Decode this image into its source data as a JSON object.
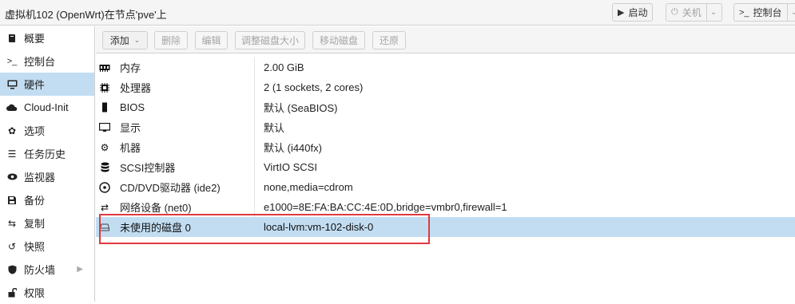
{
  "header": {
    "title": "虚拟机102 (OpenWrt)在节点'pve'上",
    "buttons": {
      "start": "启动",
      "shutdown": "关机",
      "console": "控制台"
    }
  },
  "sidebar": {
    "items": [
      {
        "label": "概要",
        "icon": "book-icon"
      },
      {
        "label": "控制台",
        "icon": "terminal-icon"
      },
      {
        "label": "硬件",
        "icon": "monitor-icon",
        "active": true
      },
      {
        "label": "Cloud-Init",
        "icon": "cloud-icon"
      },
      {
        "label": "选项",
        "icon": "gear-icon"
      },
      {
        "label": "任务历史",
        "icon": "list-icon"
      },
      {
        "label": "监视器",
        "icon": "eye-icon"
      },
      {
        "label": "备份",
        "icon": "floppy-icon"
      },
      {
        "label": "复制",
        "icon": "retweet-icon"
      },
      {
        "label": "快照",
        "icon": "history-icon"
      },
      {
        "label": "防火墙",
        "icon": "shield-icon"
      },
      {
        "label": "权限",
        "icon": "unlock-icon"
      }
    ]
  },
  "toolbar": {
    "add": "添加",
    "remove": "删除",
    "edit": "编辑",
    "resize": "调整磁盘大小",
    "move": "移动磁盘",
    "revert": "还原"
  },
  "hardware": [
    {
      "key": "内存",
      "value": "2.00 GiB",
      "icon": "memory-icon"
    },
    {
      "key": "处理器",
      "value": "2 (1 sockets, 2 cores)",
      "icon": "cpu-icon"
    },
    {
      "key": "BIOS",
      "value": "默认 (SeaBIOS)",
      "icon": "microchip-icon"
    },
    {
      "key": "显示",
      "value": "默认",
      "icon": "desktop-icon"
    },
    {
      "key": "机器",
      "value": "默认 (i440fx)",
      "icon": "cogs-icon"
    },
    {
      "key": "SCSI控制器",
      "value": "VirtIO SCSI",
      "icon": "database-icon"
    },
    {
      "key": "CD/DVD驱动器 (ide2)",
      "value": "none,media=cdrom",
      "icon": "cdrom-icon"
    },
    {
      "key": "网络设备 (net0)",
      "value": "e1000=8E:FA:BA:CC:4E:0D,bridge=vmbr0,firewall=1",
      "icon": "exchange-icon"
    },
    {
      "key": "未使用的磁盘 0",
      "value": "local-lvm:vm-102-disk-0",
      "icon": "hdd-icon",
      "selected": true
    }
  ],
  "colors": {
    "selection": "#c2ddf2",
    "highlight": "#e0393e"
  }
}
